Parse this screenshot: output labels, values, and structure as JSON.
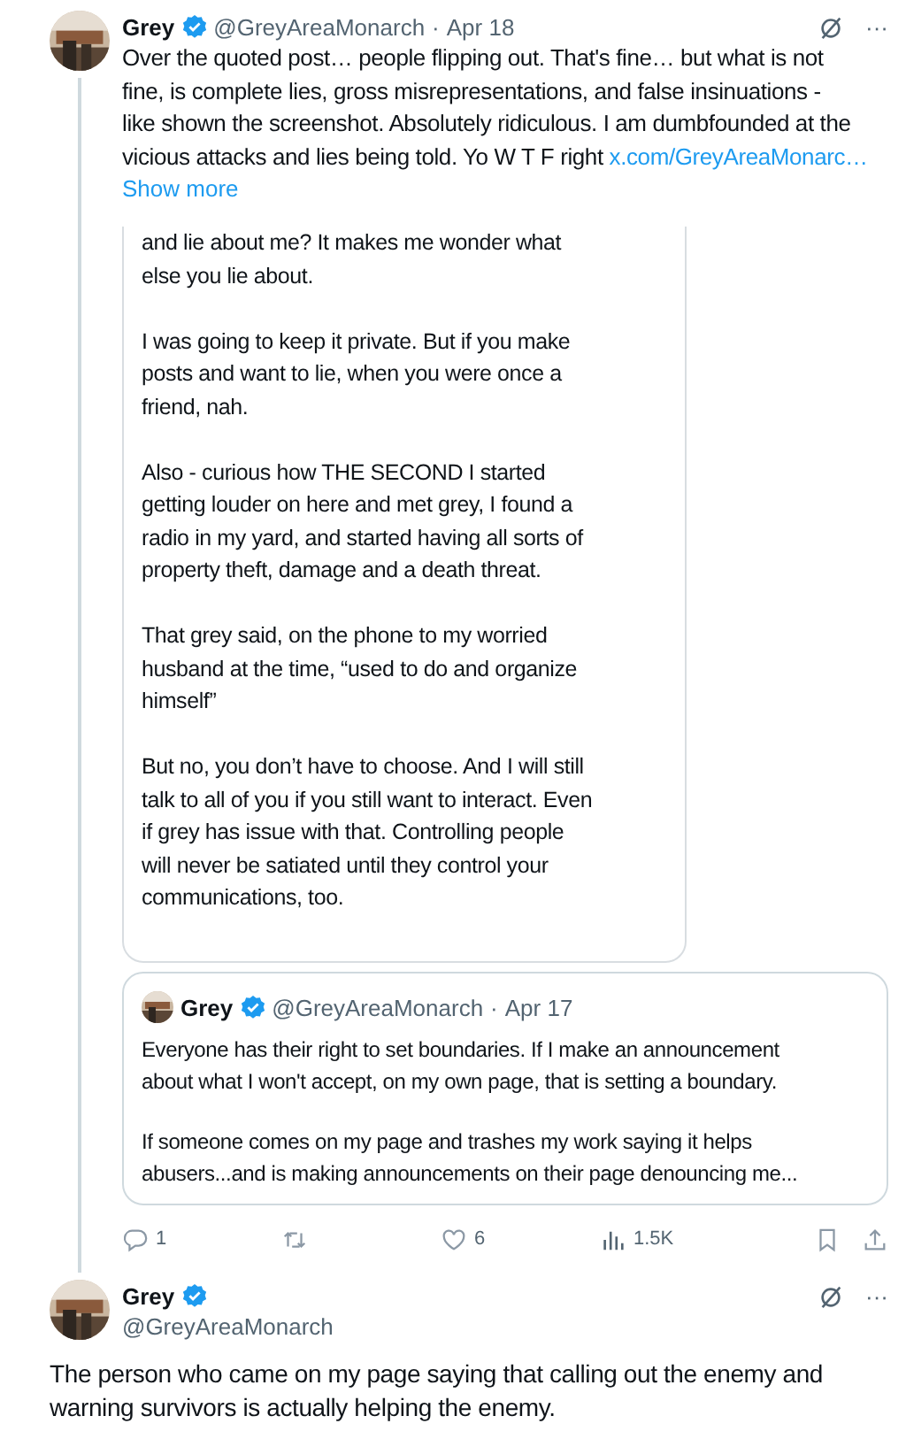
{
  "main_post": {
    "name": "Grey",
    "verified": true,
    "handle": "@GreyAreaMonarch",
    "dot": "·",
    "date": "Apr 18",
    "more": "···",
    "text_lines": [
      "Over the quoted post… people flipping out. That's fine… but what is not",
      "fine, is complete lies, gross misrepresentations, and false insinuations -",
      "like shown the screenshot. Absolutely ridiculous. I am dumbfounded at the",
      "vicious attacks and lies being told. Yo W T F right"
    ],
    "link": "x.com/GreyAreaMonarc…",
    "show_more": "Show more",
    "image_paragraphs": [
      [
        "and lie about me? It makes me wonder what",
        "else you lie about."
      ],
      [
        "I was going to keep it private. But if you make",
        "posts and want to lie, when you were once a",
        "friend, nah."
      ],
      [
        "Also - curious how THE SECOND I started",
        "getting louder on here and met grey, I found a",
        "radio in my yard, and started having all sorts of",
        "property theft, damage and a death threat."
      ],
      [
        "That grey said, on the phone to my worried",
        "husband at the time, “used to do and organize",
        "himself”"
      ],
      [
        "But no, you don’t have to choose. And I will still",
        "talk to all of you if you still want to interact. Even",
        "if grey has issue with that. Controlling people",
        "will never be satiated until they control your",
        "communications, too."
      ]
    ],
    "quote": {
      "name": "Grey",
      "verified": true,
      "handle": "@GreyAreaMonarch",
      "dot": "·",
      "date": "Apr 17",
      "paragraphs": [
        [
          "Everyone has their right to set boundaries. If I make an announcement",
          "about what I won't accept, on my own page, that is setting a boundary."
        ],
        [
          "If someone comes on my page and trashes my work saying it helps",
          "abusers...and is making announcements on their page denouncing me..."
        ]
      ]
    },
    "actions": [
      {
        "kind": "reply",
        "count": "1"
      },
      {
        "kind": "repost"
      },
      {
        "kind": "like",
        "count": "6"
      },
      {
        "kind": "views",
        "count": "1.5K"
      },
      {
        "kind": "bookmark"
      },
      {
        "kind": "share"
      }
    ]
  },
  "reply_post": {
    "name": "Grey",
    "verified": true,
    "handle": "@GreyAreaMonarch",
    "more": "···",
    "text_lines": [
      "The person who came on my page saying that calling out the enemy and",
      "warning survivors is actually helping the enemy."
    ]
  }
}
